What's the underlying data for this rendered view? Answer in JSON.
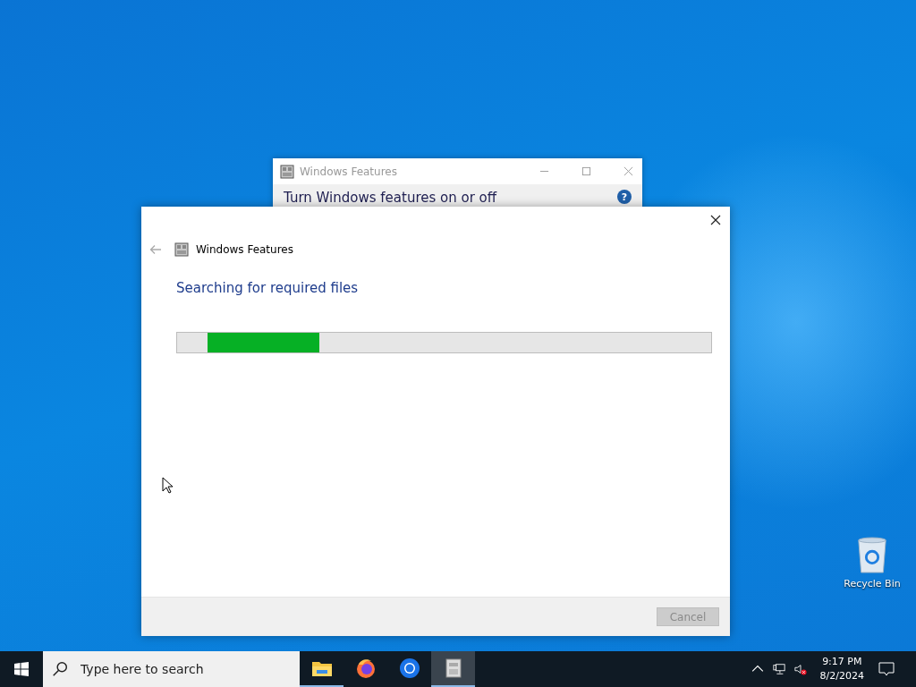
{
  "desktop_icons": [
    {
      "label": "Recycle Bin"
    }
  ],
  "back_window": {
    "title": "Windows Features",
    "heading": "Turn Windows features on or off",
    "help": "?"
  },
  "dialog": {
    "title": "Windows Features",
    "status": "Searching for required files",
    "progress": {
      "level": 0.21
    },
    "buttons": [
      {
        "label": "Cancel",
        "disabled": true
      }
    ]
  },
  "taskbar": {
    "search": {
      "placeholder": "Type here to search"
    },
    "apps": [
      {
        "kind": "folder",
        "running": true,
        "selected": false
      },
      {
        "kind": "firefox",
        "running": false,
        "selected": false
      },
      {
        "kind": "chrome",
        "running": false,
        "selected": false
      },
      {
        "kind": "features",
        "running": true,
        "selected": true
      }
    ],
    "clock": {
      "time": "9:17 PM",
      "date": "8/2/2024"
    }
  }
}
